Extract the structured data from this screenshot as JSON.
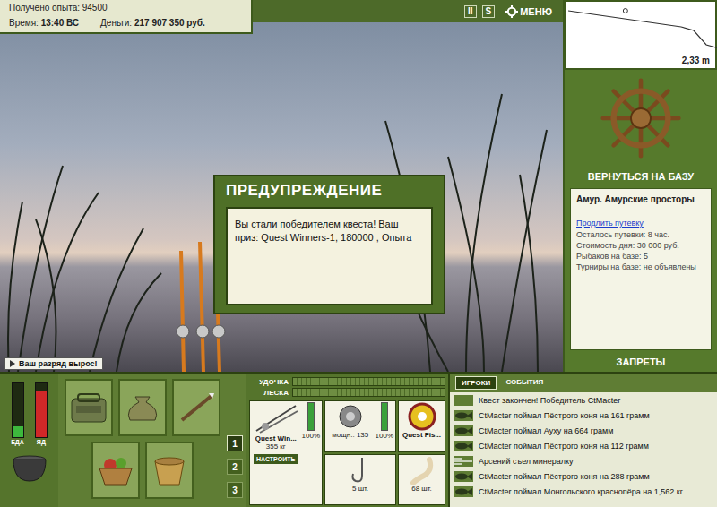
{
  "stats": {
    "experience_label": "Получено опыта:",
    "experience": "94500",
    "time_label": "Время:",
    "time": "13:40 ВС",
    "money_label": "Деньги:",
    "money": "217 907 350 руб."
  },
  "toolbar": {
    "pause": "II",
    "sound": "S",
    "menu": "МЕНЮ"
  },
  "depth_chart": {
    "values": [
      0.4,
      0.5,
      0.6,
      0.7,
      0.8,
      0.9,
      1.0,
      1.1,
      1.2,
      1.3,
      1.5,
      2.3,
      2.5
    ],
    "marker_level": 0.38,
    "reading": "2,33 m"
  },
  "base": {
    "return_button": "ВЕРНУТЬСЯ НА БАЗУ",
    "name": "Амур. Амурские просторы",
    "extend_link": "Продлить путевку",
    "info": [
      "Осталось путевки: 8 час.",
      "Стоимость дня: 30 000 руб.",
      "Рыбаков на базе: 5",
      "Турниры на базе: не объявлены"
    ],
    "bans_button": "ЗАПРЕТЫ"
  },
  "dialog": {
    "title": "ПРЕДУПРЕЖДЕНИЕ",
    "message": "Вы стали победителем квеста! Ваш приз: Quest Winners-1, 180000 , Опыта"
  },
  "rank_notice": "Ваш разряд вырос!",
  "meters": [
    {
      "label": "ЕДА",
      "level": 0.2,
      "color": "#3db83d"
    },
    {
      "label": "ЯД",
      "level": 0.85,
      "color": "#d02828"
    }
  ],
  "inventory": {
    "slots": [
      {
        "kind": "bag"
      },
      {
        "kind": "sack"
      },
      {
        "kind": "case"
      },
      {
        "kind": "basket"
      },
      {
        "kind": "bucket"
      }
    ],
    "pages": [
      {
        "label": "1",
        "selected": true
      },
      {
        "label": "2",
        "selected": false
      },
      {
        "label": "3",
        "selected": false
      }
    ]
  },
  "tension": [
    {
      "label": "УДОЧКА",
      "level": 0
    },
    {
      "label": "ЛЕСКА",
      "level": 0
    }
  ],
  "tackle": {
    "rod": {
      "name": "Quest Win...",
      "load": "355 кг",
      "durability": "100%",
      "level": 1
    },
    "reel": {
      "power": "мощн.: 135",
      "durability": "100%",
      "level": 1
    },
    "line": {
      "name": "Quest Fis..."
    },
    "hook": {
      "count": "5 шт."
    },
    "bait": {
      "count": "68 шт."
    },
    "setup_button": "НАСТРОИТЬ"
  },
  "feed": {
    "tabs": [
      {
        "label": "ИГРОКИ",
        "selected": true
      },
      {
        "label": "СОБЫТИЯ",
        "selected": false
      }
    ],
    "items": [
      {
        "kind": "system",
        "text": "Квест закончен! Победитель CtMacter"
      },
      {
        "kind": "catch",
        "text": "CtMacter поймал Пёстрого коня на 161 грамм"
      },
      {
        "kind": "catch",
        "text": "CtMacter поймал Ауху на 664 грамм"
      },
      {
        "kind": "catch",
        "text": "CtMacter поймал Пёстрого коня на 112 грамм"
      },
      {
        "kind": "eat",
        "text": "Арсений съел минералку"
      },
      {
        "kind": "catch",
        "text": "CtMacter поймал Пёстрого коня на 288 грамм"
      },
      {
        "kind": "catch",
        "text": "CtMacter поймал Монгольского краснопёра на 1,562 кг"
      }
    ]
  }
}
